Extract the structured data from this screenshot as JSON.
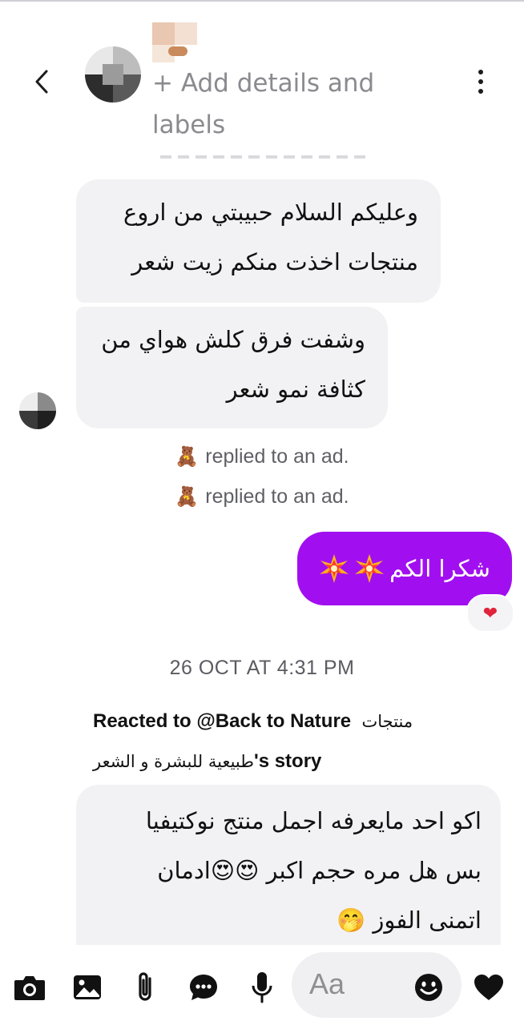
{
  "header": {
    "add_details": "+ Add details and labels"
  },
  "messages": {
    "incoming_1": "وعليكم السلام حبيبتي من اروع منتجات اخذت منكم زيت شعر",
    "incoming_2": "وشفت فرق كلش هواي من كثافة نمو شعر",
    "system_1": "replied to an ad.",
    "system_2": "replied to an ad.",
    "outgoing_1": "شكرا الكم",
    "reaction": "❤",
    "timestamp": "26 OCT AT 4:31 PM",
    "reacted_prefix": "Reacted to @Back to Nature",
    "reacted_page_ar_1": "منتجات",
    "reacted_page_ar_2": "طبيعية للبشرة و الشعر",
    "reacted_suffix": "'s story",
    "incoming_3_line_1": "اكو احد مايعرفه اجمل منتج نوكتيفيا",
    "incoming_3_line_2": "بس هل مره حجم اكبر 😍😍ادمان",
    "incoming_3_line_3": "اتمنى الفوز 🤭"
  },
  "composer": {
    "placeholder": "Aa"
  },
  "icons": {
    "back": "chevron-left-icon",
    "more": "more-vertical-icon",
    "camera": "camera-icon",
    "gallery": "image-icon",
    "attach": "paperclip-icon",
    "chat": "chat-bubble-icon",
    "mic": "microphone-icon",
    "emoji": "smiley-icon",
    "like": "heart-icon"
  },
  "colors": {
    "outgoing_bubble": "#a10ff0",
    "incoming_bubble": "#f2f2f4",
    "muted_text": "#8a8a8f"
  }
}
